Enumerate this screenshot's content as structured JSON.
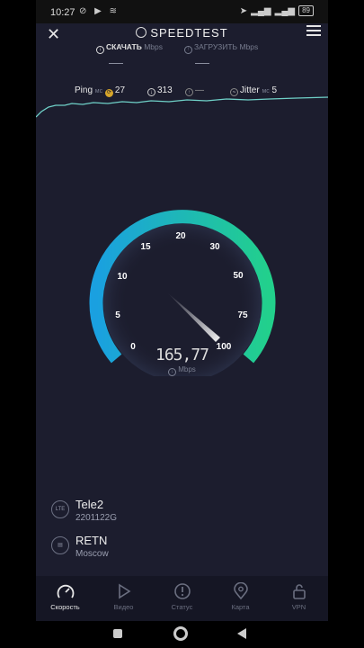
{
  "status_bar": {
    "time": "10:27",
    "battery": "89"
  },
  "header": {
    "title": "SPEEDTEST"
  },
  "tests": {
    "download_label": "СКАЧАТЬ",
    "upload_label": "ЗАГРУЗИТЬ",
    "unit": "Mbps"
  },
  "stats": {
    "ping_label": "Ping",
    "ping_unit": "мс",
    "ping_value": "27",
    "ping_down_value": "313",
    "ping_up_value": "—",
    "jitter_label": "Jitter",
    "jitter_unit": "мс",
    "jitter_value": "5"
  },
  "gauge": {
    "ticks": [
      "0",
      "5",
      "10",
      "15",
      "20",
      "30",
      "50",
      "75",
      "100"
    ],
    "value": "165,77",
    "unit": "Mbps"
  },
  "provider": {
    "name": "Tele2",
    "ip": "2201122G",
    "icon_label": "LTE"
  },
  "server": {
    "name": "RETN",
    "location": "Moscow"
  },
  "nav": [
    {
      "label": "Скорость",
      "icon": "speedometer-icon"
    },
    {
      "label": "Видео",
      "icon": "play-icon"
    },
    {
      "label": "Статус",
      "icon": "alert-icon"
    },
    {
      "label": "Карта",
      "icon": "map-pin-icon"
    },
    {
      "label": "VPN",
      "icon": "lock-icon"
    }
  ],
  "colors": {
    "background": "#1c1d2e",
    "gauge_start": "#1aa0e0",
    "gauge_end": "#22d08c"
  }
}
